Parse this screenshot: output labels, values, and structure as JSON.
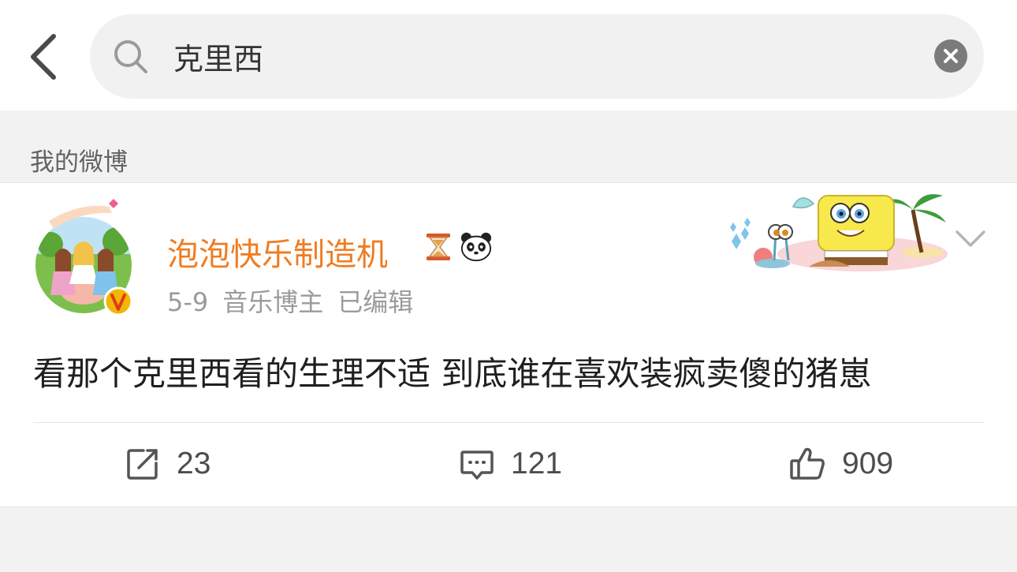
{
  "search": {
    "query": "克里西",
    "placeholder": ""
  },
  "section": {
    "title": "我的微博"
  },
  "post": {
    "author": "泡泡快乐制造机",
    "author_badges": [
      "hourglass-icon",
      "panda-icon"
    ],
    "date": "5-9",
    "tag": "音乐博主",
    "edited": "已编辑",
    "text": "看那个克里西看的生理不适 到底谁在喜欢装疯卖傻的猪崽",
    "reposts": "23",
    "comments": "121",
    "likes": "909"
  },
  "colors": {
    "username": "#f07c22",
    "verified_badge": "#f2b705",
    "background": "#f2f2f2"
  }
}
